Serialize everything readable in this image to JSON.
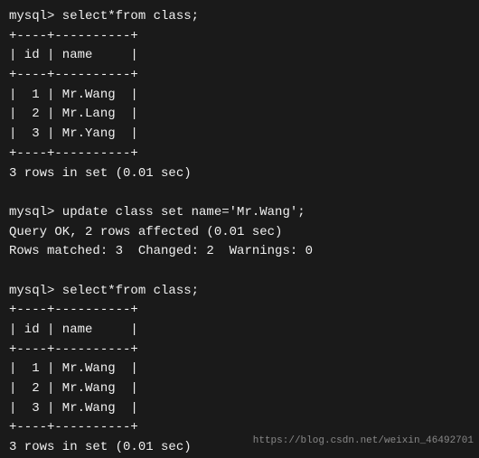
{
  "terminal": {
    "lines": [
      "mysql> select*from class;",
      "+----+----------+",
      "| id | name     |",
      "+----+----------+",
      "|  1 | Mr.Wang  |",
      "|  2 | Mr.Lang  |",
      "|  3 | Mr.Yang  |",
      "+----+----------+",
      "3 rows in set (0.01 sec)",
      "",
      "mysql> update class set name='Mr.Wang';",
      "Query OK, 2 rows affected (0.01 sec)",
      "Rows matched: 3  Changed: 2  Warnings: 0",
      "",
      "mysql> select*from class;",
      "+----+----------+",
      "| id | name     |",
      "+----+----------+",
      "|  1 | Mr.Wang  |",
      "|  2 | Mr.Wang  |",
      "|  3 | Mr.Wang  |",
      "+----+----------+",
      "3 rows in set (0.01 sec)"
    ],
    "watermark": "https://blog.csdn.net/weixin_46492701"
  }
}
